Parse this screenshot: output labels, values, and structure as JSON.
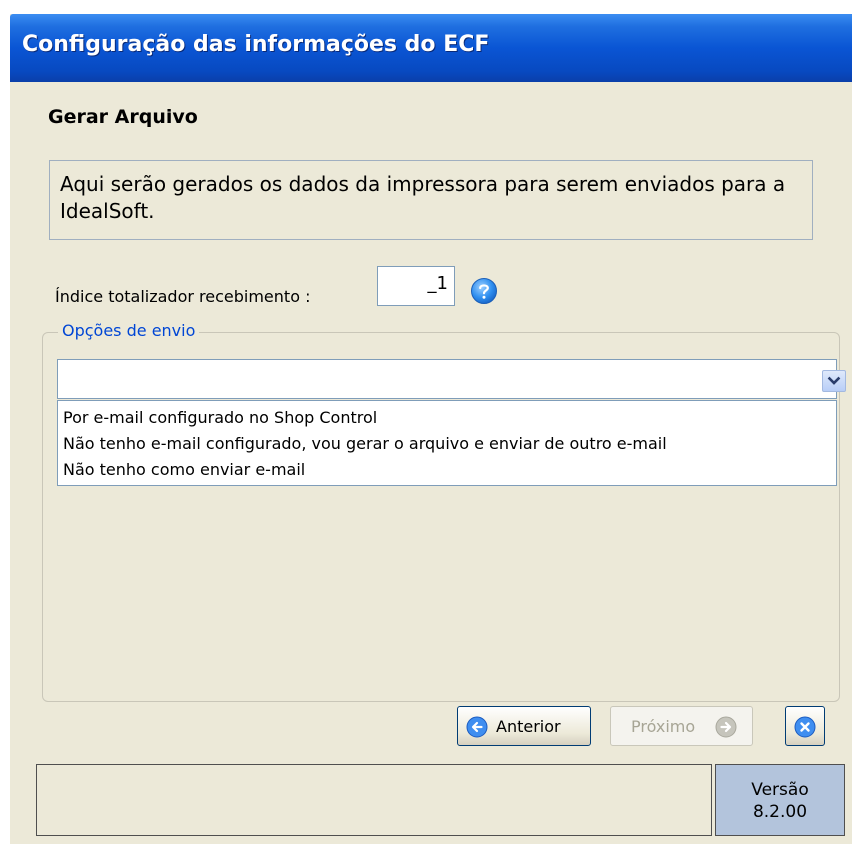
{
  "window": {
    "title": "Configuração das informações do ECF"
  },
  "heading": "Gerar Arquivo",
  "description": "Aqui serão gerados os dados da impressora para serem enviados para a IdealSoft.",
  "index_field": {
    "label": "Índice totalizador recebimento :",
    "value": "_1",
    "help_icon": "question-circle-icon"
  },
  "send_options": {
    "legend": "Opções de envio",
    "selected": "",
    "options": [
      "Por e-mail configurado no Shop Control",
      "Não tenho e-mail configurado, vou gerar o arquivo e enviar de outro e-mail",
      "Não tenho como enviar e-mail"
    ]
  },
  "buttons": {
    "previous_label": "Anterior",
    "next_label": "Próximo",
    "next_enabled": false,
    "close_icon": "close-circle-icon"
  },
  "version": {
    "label": "Versão",
    "number": "8.2.00"
  },
  "colors": {
    "titlebar": "#0a55d4",
    "window_bg": "#ece9d8",
    "legend_text": "#0046d5",
    "version_bg": "#b3c4dc"
  }
}
